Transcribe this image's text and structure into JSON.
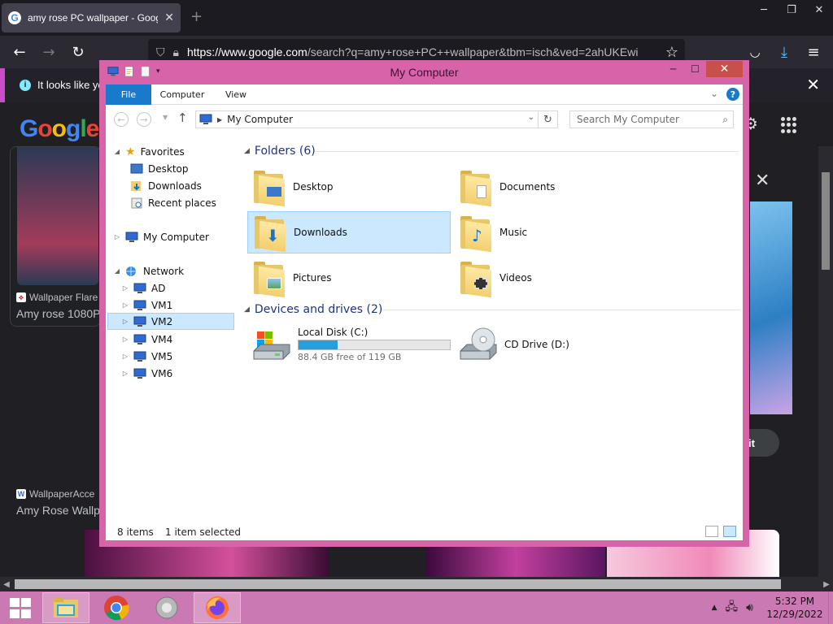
{
  "browser": {
    "tab_title": "amy rose PC wallpaper - Google",
    "tab_close": "✕",
    "new_tab": "+",
    "url_host": "https://www.google.com",
    "url_path": "/search?q=amy+rose+PC++wallpaper&tbm=isch&ved=2ahUKEwi",
    "infobar_text": "It looks like you",
    "google_logo": "Google",
    "results": [
      {
        "source": "Wallpaper Flare",
        "desc": "Amy rose 1080P"
      },
      {
        "source": "WallpaperAcce",
        "desc": "Amy Rose Wallp"
      }
    ],
    "visit_label": "it"
  },
  "explorer": {
    "title": "My Computer",
    "ribbon_tabs": [
      "File",
      "Computer",
      "View"
    ],
    "address": "My Computer",
    "search_placeholder": "Search My Computer",
    "nav": {
      "favorites": "Favorites",
      "favorite_items": [
        "Desktop",
        "Downloads",
        "Recent places"
      ],
      "my_computer": "My Computer",
      "network": "Network",
      "network_items": [
        "AD",
        "VM1",
        "VM2",
        "VM4",
        "VM5",
        "VM6"
      ],
      "selected": "VM2"
    },
    "folders_header": "Folders (6)",
    "folders": [
      "Desktop",
      "Documents",
      "Downloads",
      "Music",
      "Pictures",
      "Videos"
    ],
    "selected_folder": "Downloads",
    "devices_header": "Devices and drives (2)",
    "drives": [
      {
        "name": "Local Disk (C:)",
        "free_text": "88.4 GB free of 119 GB",
        "used_fraction": 0.26
      },
      {
        "name": "CD Drive (D:)"
      }
    ],
    "status": {
      "count": "8 items",
      "selection": "1 item selected"
    }
  },
  "taskbar": {
    "time": "5:32 PM",
    "date": "12/29/2022"
  },
  "colors": {
    "window_frame": "#d763a8",
    "taskbar": "#cb79b3",
    "selection": "#cce8ff",
    "accent": "#1979ca"
  }
}
